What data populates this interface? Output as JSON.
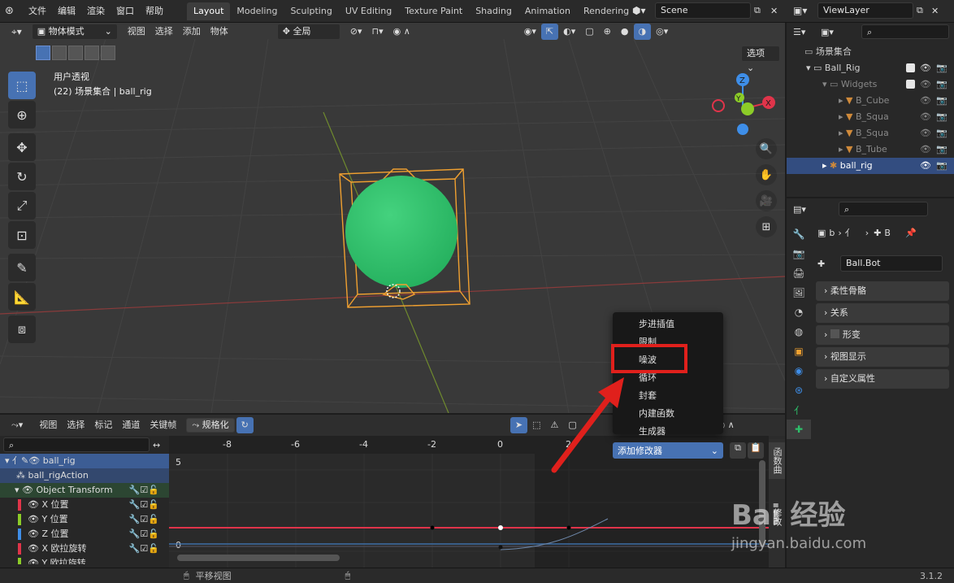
{
  "topbar": {
    "menus": [
      "文件",
      "编辑",
      "渲染",
      "窗口",
      "帮助"
    ],
    "workspaces": [
      "Layout",
      "Modeling",
      "Sculpting",
      "UV Editing",
      "Texture Paint",
      "Shading",
      "Animation",
      "Rendering"
    ],
    "scene": "Scene",
    "view_layer": "ViewLayer"
  },
  "viewport": {
    "mode": "物体模式",
    "menus": [
      "视图",
      "选择",
      "添加",
      "物体"
    ],
    "orientation": "全局",
    "options_label": "选项",
    "overlay_title": "用户透视",
    "overlay_subtitle": "(22) 场景集合 | ball_rig",
    "gizmo": {
      "x": "X",
      "y": "Y",
      "z": "Z"
    }
  },
  "outliner": {
    "root": "场景集合",
    "rows": [
      {
        "label": "Ball_Rig"
      },
      {
        "label": "Widgets"
      },
      {
        "label": "B_Cube"
      },
      {
        "label": "B_Squa"
      },
      {
        "label": "B_Squa"
      },
      {
        "label": "B_Tube"
      },
      {
        "label": "ball_rig"
      }
    ]
  },
  "properties": {
    "breadcrumb": {
      "obj": "b",
      "bone": "B"
    },
    "bone_name": "Ball.Bot",
    "panels": [
      "柔性骨骼",
      "关系",
      "形变",
      "视图显示",
      "自定义属性"
    ]
  },
  "graph": {
    "menus": [
      "视图",
      "选择",
      "标记",
      "通道",
      "关键帧"
    ],
    "normalize_label": "规格化",
    "ticks": [
      "-8",
      "-6",
      "-4",
      "-2",
      "0",
      "2"
    ],
    "y_labels": {
      "top": "5",
      "bottom": "0"
    },
    "channels": [
      {
        "label": "ball_rig",
        "color": ""
      },
      {
        "label": "ball_rigAction",
        "color": ""
      },
      {
        "label": "Object Transform",
        "color": ""
      },
      {
        "label": "X 位置",
        "color": "#e0344a"
      },
      {
        "label": "Y 位置",
        "color": "#8ccc28"
      },
      {
        "label": "Z 位置",
        "color": "#3e8ee8"
      },
      {
        "label": "X 欧拉旋转",
        "color": "#e0344a"
      },
      {
        "label": "Y 欧拉旋转",
        "color": "#8ccc28"
      }
    ],
    "side_tabs": [
      "函数曲",
      "修改"
    ]
  },
  "popup": {
    "items": [
      "步进插值",
      "限制",
      "噪波",
      "循环",
      "封套",
      "内建函数",
      "生成器"
    ],
    "add_modifier": "添加修改器"
  },
  "status": {
    "hint": "平移视图",
    "version": "3.1.2"
  },
  "watermark": {
    "text": "Bai 经验",
    "url": "jingyan.baidu.com"
  },
  "colors": {
    "accent": "#4772b3",
    "highlight_box": "#e0201c",
    "sphere": "#2ebf6a",
    "selection": "#f0a030"
  }
}
